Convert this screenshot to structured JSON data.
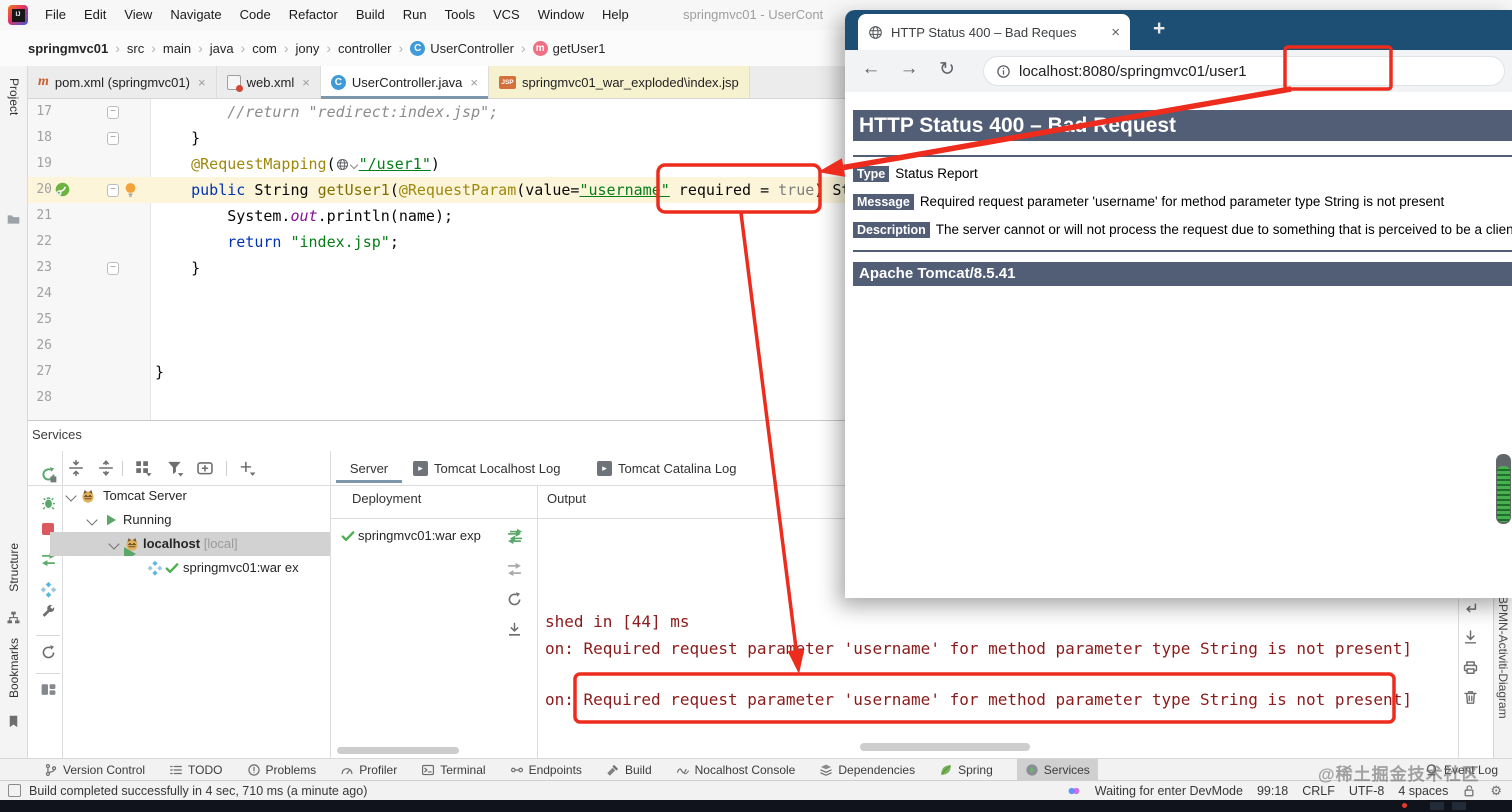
{
  "colors": {
    "annotation_red": "#ee2c1d",
    "tomcat_band": "#525d76",
    "console_text": "#8b1a1a",
    "browser_chrome": "#1d4e74",
    "keyword_blue": "#0033b3",
    "string_green": "#067d17",
    "annotation_olive": "#9e880d",
    "selected_tab_underline": "#7d96aa"
  },
  "menubar": {
    "menus": [
      "File",
      "Edit",
      "View",
      "Navigate",
      "Code",
      "Refactor",
      "Build",
      "Run",
      "Tools",
      "VCS",
      "Window",
      "Help"
    ],
    "window_title": "springmvc01 - UserCont"
  },
  "breadcrumbs": {
    "items": [
      {
        "label": "springmvc01",
        "bold": true
      },
      {
        "label": "src"
      },
      {
        "label": "main"
      },
      {
        "label": "java"
      },
      {
        "label": "com"
      },
      {
        "label": "jony"
      },
      {
        "label": "controller"
      },
      {
        "label": "UserController",
        "icon": "class"
      },
      {
        "label": "getUser1",
        "icon": "method"
      }
    ]
  },
  "editor_tabs": [
    {
      "label": "pom.xml (springmvc01)",
      "icon": "maven",
      "closable": true
    },
    {
      "label": "web.xml",
      "icon": "webxml",
      "closable": true
    },
    {
      "label": "UserController.java",
      "icon": "class",
      "closable": true,
      "selected": true
    },
    {
      "label": "springmvc01_war_exploded\\index.jsp",
      "icon": "jsp",
      "modified": true
    }
  ],
  "left_dock": {
    "top_label": "Project",
    "middle_label": "Structure",
    "bottom_label": "Bookmarks"
  },
  "editor": {
    "lines": [
      {
        "n": "17",
        "fold": true,
        "tokens": [
          {
            "c": "cmt",
            "t": "        //return \"redirect:index.jsp\";"
          }
        ]
      },
      {
        "n": "18",
        "fold": true,
        "tokens": [
          {
            "c": "pln",
            "t": "    }"
          }
        ]
      },
      {
        "n": "19",
        "tokens": [
          {
            "c": "ann",
            "t": "    @RequestMapping"
          },
          {
            "c": "pln",
            "t": "("
          },
          {
            "c": "icon-globe",
            "t": ""
          },
          {
            "c": "str-u",
            "t": "\"/user1\""
          },
          {
            "c": "pln",
            "t": ")"
          }
        ]
      },
      {
        "n": "20",
        "fold": true,
        "current": true,
        "gutter": [
          "run",
          "bulb"
        ],
        "tokens": [
          {
            "c": "kw",
            "t": "    public"
          },
          {
            "c": "pln",
            "t": " String "
          },
          {
            "c": "meth",
            "t": "getUser1"
          },
          {
            "c": "pln",
            "t": "("
          },
          {
            "c": "ann",
            "t": "@RequestParam"
          },
          {
            "c": "pln",
            "t": "(value="
          },
          {
            "c": "str-u",
            "t": "\"username\""
          },
          {
            "c": "pln",
            "t": " required = "
          },
          {
            "c": "gray",
            "t": "true"
          },
          {
            "c": "pln",
            "t": ") St"
          }
        ]
      },
      {
        "n": "21",
        "tokens": [
          {
            "c": "pln",
            "t": "        System."
          },
          {
            "c": "field",
            "t": "out"
          },
          {
            "c": "pln",
            "t": ".println(name);"
          }
        ]
      },
      {
        "n": "22",
        "tokens": [
          {
            "c": "kw",
            "t": "        return"
          },
          {
            "c": "pln",
            "t": " "
          },
          {
            "c": "str",
            "t": "\"index.jsp\""
          },
          {
            "c": "pln",
            "t": ";"
          }
        ]
      },
      {
        "n": "23",
        "fold": true,
        "tokens": [
          {
            "c": "pln",
            "t": "    }"
          }
        ]
      },
      {
        "n": "24",
        "tokens": []
      },
      {
        "n": "25",
        "tokens": []
      },
      {
        "n": "26",
        "tokens": []
      },
      {
        "n": "27",
        "tokens": [
          {
            "c": "pln",
            "t": "}"
          }
        ]
      },
      {
        "n": "28",
        "tokens": []
      }
    ]
  },
  "services": {
    "title": "Services",
    "left_toolbar_icons": [
      "rerun",
      "debug-rerun",
      "stop",
      "deploy",
      "artifact",
      "settings-wrench",
      "refresh",
      "layout"
    ],
    "tree_toolbar_icons": [
      "expand-all",
      "collapse-all",
      "group-by",
      "filter",
      "add-frame",
      "add"
    ],
    "tree": {
      "root": "Tomcat Server",
      "running": "Running",
      "host": "localhost",
      "host_suffix": "[local]",
      "artifact": "springmvc01:war ex"
    },
    "tabs": [
      "Server",
      "Tomcat Localhost Log",
      "Tomcat Catalina Log"
    ],
    "columns": [
      "Deployment",
      "Output"
    ],
    "deployment_row": "springmvc01:war exp",
    "deployment_gutter_icons": [
      "deploy",
      "sync",
      "refresh",
      "dock"
    ],
    "console_lines": [
      "shed in [44] ms",
      "on: Required request parameter 'username' for method parameter type String is not present]",
      "on: Required request parameter 'username' for method parameter type String is not present]"
    ],
    "console_right_icons": [
      "soft-wrap",
      "scroll-to-end",
      "print",
      "clear"
    ],
    "right_tab": "BPMN-Activiti-Diagram"
  },
  "browser": {
    "tab_title": "HTTP Status 400 – Bad Reques",
    "new_tab_label": "+",
    "close_label": "×",
    "url": "localhost:8080/springmvc01/user1",
    "page": {
      "h1": "HTTP Status 400 – Bad Request",
      "rows": [
        {
          "label": "Type",
          "text": "Status Report"
        },
        {
          "label": "Message",
          "text": "Required request parameter 'username' for method parameter type String is not present"
        },
        {
          "label": "Description",
          "text": "The server cannot or will not process the request due to something that is perceived to be a client error"
        }
      ],
      "footer": "Apache Tomcat/8.5.41"
    }
  },
  "bottom_bar": {
    "items": [
      {
        "label": "Version Control",
        "icon": "branch"
      },
      {
        "label": "TODO",
        "icon": "checklist"
      },
      {
        "label": "Problems",
        "icon": "error"
      },
      {
        "label": "Profiler",
        "icon": "gauge"
      },
      {
        "label": "Terminal",
        "icon": "terminal"
      },
      {
        "label": "Endpoints",
        "icon": "endpoints"
      },
      {
        "label": "Build",
        "icon": "hammer"
      },
      {
        "label": "Nocalhost Console",
        "icon": "waves"
      },
      {
        "label": "Dependencies",
        "icon": "layers"
      },
      {
        "label": "Spring",
        "icon": "spring-leaf"
      },
      {
        "label": "Services",
        "icon": "services-play",
        "selected": true
      }
    ],
    "right_item": {
      "label": "Event Log",
      "icon": "bell"
    }
  },
  "status_bar": {
    "message": "Build completed successfully in 4 sec, 710 ms (a minute ago)",
    "devmode": "Waiting for enter DevMode",
    "position": "99:18",
    "line_ending": "CRLF",
    "encoding": "UTF-8",
    "indent": "4 spaces"
  },
  "watermark": "@稀土掘金技术社区"
}
